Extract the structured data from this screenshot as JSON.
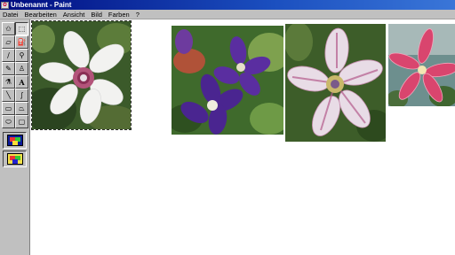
{
  "window": {
    "title": "Unbenannt - Paint"
  },
  "menu": [
    {
      "label": "Datei"
    },
    {
      "label": "Bearbeiten"
    },
    {
      "label": "Ansicht"
    },
    {
      "label": "Bild"
    },
    {
      "label": "Farben"
    },
    {
      "label": "?"
    }
  ],
  "tools": [
    {
      "name": "free-form-select-icon",
      "glyph": "✩"
    },
    {
      "name": "select-icon",
      "glyph": "⬚"
    },
    {
      "name": "eraser-icon",
      "glyph": "▱"
    },
    {
      "name": "fill-bucket-icon",
      "glyph": "⛽"
    },
    {
      "name": "color-picker-icon",
      "glyph": "∕"
    },
    {
      "name": "magnifier-icon",
      "glyph": "⚲"
    },
    {
      "name": "pencil-icon",
      "glyph": "✎"
    },
    {
      "name": "brush-icon",
      "glyph": "♙"
    },
    {
      "name": "airbrush-icon",
      "glyph": "⚗"
    },
    {
      "name": "text-icon",
      "glyph": "A"
    },
    {
      "name": "line-icon",
      "glyph": "╲"
    },
    {
      "name": "curve-icon",
      "glyph": "∫"
    },
    {
      "name": "rectangle-icon",
      "glyph": "▭"
    },
    {
      "name": "polygon-icon",
      "glyph": "⏢"
    },
    {
      "name": "ellipse-icon",
      "glyph": "⬭"
    },
    {
      "name": "rounded-rectangle-icon",
      "glyph": "▢"
    }
  ],
  "selected_tool": "select-icon",
  "colors": {
    "titlebar_start": "#000c80",
    "titlebar_end": "#3a76d8",
    "chrome": "#c0c0c0"
  }
}
